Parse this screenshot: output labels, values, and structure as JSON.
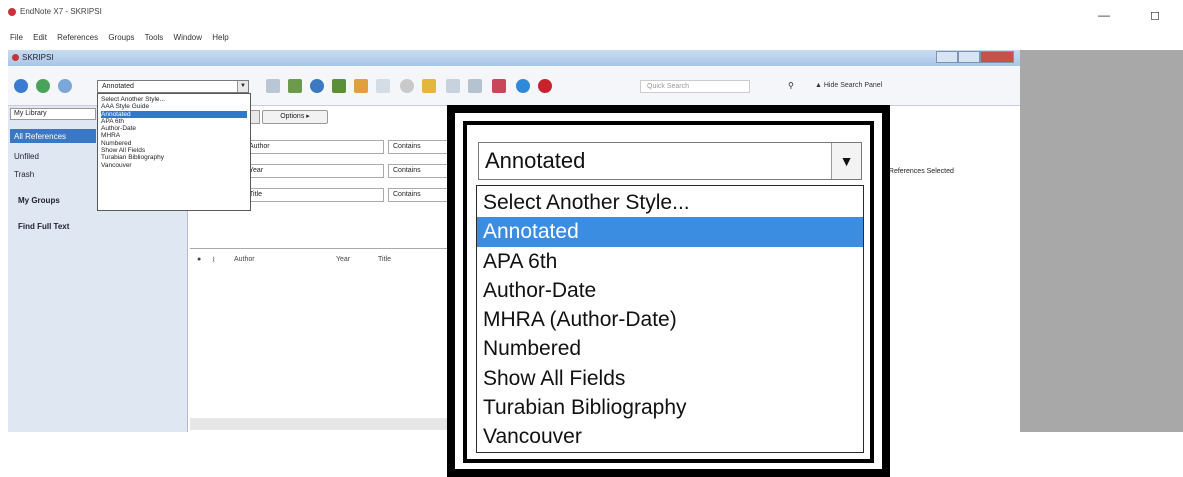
{
  "app": {
    "window_title": "EndNote X7 - SKRIPSI",
    "doc_title": "SKRIPSI"
  },
  "menu": [
    "File",
    "Edit",
    "References",
    "Groups",
    "Tools",
    "Window",
    "Help"
  ],
  "toolbar": {
    "style_value": "Annotated",
    "quick_search_placeholder": "Quick Search",
    "hide_search_label": "Hide Search Panel"
  },
  "style_dropdown": {
    "small_options": [
      "Select Another Style...",
      "AAA Style Guide",
      "Annotated",
      "APA 6th",
      "Author-Date",
      "MHRA",
      "Numbered",
      "Show All Fields",
      "Turabian Bibliography",
      "Vancouver"
    ],
    "small_selected_index": 2
  },
  "sidebar": {
    "library_select": "My Library",
    "all_refs": "All References",
    "unfiled": "Unfiled",
    "trash": "Trash",
    "my_groups": "My Groups",
    "find_full_text": "Find Full Text"
  },
  "search": {
    "options_label": "Options ▸",
    "rows": [
      {
        "field": "Author",
        "op": "Contains"
      },
      {
        "field": "Year",
        "op": "Contains"
      },
      {
        "field": "Title",
        "op": "Contains"
      }
    ]
  },
  "ref_columns": [
    "Author",
    "Year",
    "Title"
  ],
  "right_panel": {
    "status": "No References Selected"
  },
  "zoom": {
    "select_value": "Annotated",
    "options": [
      "Select Another Style...",
      "Annotated",
      "APA 6th",
      "Author-Date",
      "MHRA (Author-Date)",
      "Numbered",
      "Show All Fields",
      "Turabian Bibliography",
      "Vancouver"
    ],
    "selected_index": 1
  },
  "colors": {
    "selection": "#3a8de0",
    "frame": "#000000",
    "side_panel": "#a8a8a8"
  }
}
